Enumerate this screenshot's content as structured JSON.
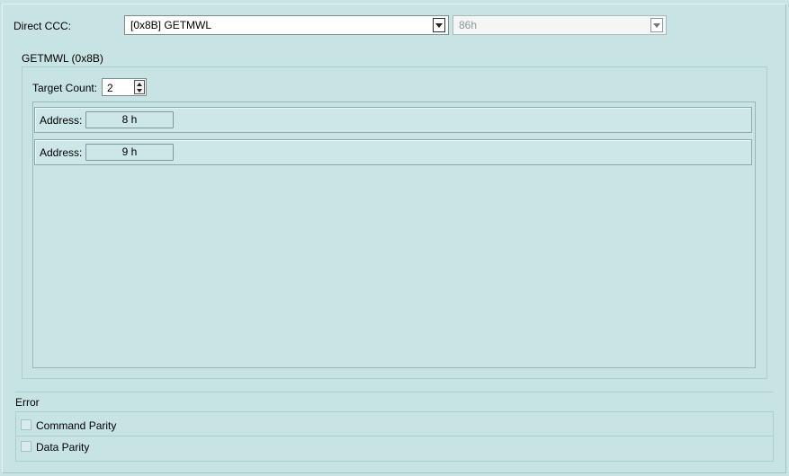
{
  "direct_ccc": {
    "label": "Direct CCC:",
    "selected": "[0x8B] GETMWL",
    "address_selected": "86h"
  },
  "getmwl_group": {
    "title": "GETMWL (0x8B)",
    "target_count_label": "Target Count:",
    "target_count_value": "2",
    "rows": [
      {
        "label": "Address:",
        "value": "8 h"
      },
      {
        "label": "Address:",
        "value": "9 h"
      }
    ]
  },
  "error_group": {
    "title": "Error",
    "items": [
      {
        "label": "Command Parity",
        "checked": false
      },
      {
        "label": "Data Parity",
        "checked": false
      }
    ]
  }
}
